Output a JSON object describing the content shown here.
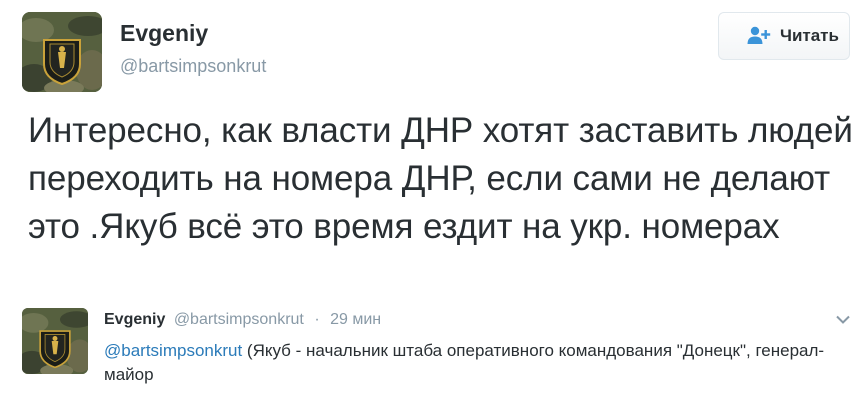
{
  "tweet": {
    "author": {
      "name": "Evgeniy",
      "handle": "@bartsimpsonkrut",
      "avatar_icon": "avatar-camo-icon"
    },
    "follow_button": {
      "label": "Читать",
      "icon": "follow-person-plus-icon",
      "icon_color": "#3b94d9"
    },
    "text": "Интересно, как власти ДНР хотят заставить людей переходить на номера ДНР, если сами не делают это .Якуб всё это время ездит на укр. номерах"
  },
  "quoted": {
    "author": {
      "name": "Evgeniy",
      "handle": "@bartsimpsonkrut",
      "avatar_icon": "avatar-camo-icon"
    },
    "separator": "·",
    "time": "29 мин",
    "mention": "@bartsimpsonkrut",
    "text": " (Якуб -  начальник штаба оперативного командования \"Донецк\", генерал-майор",
    "caret_icon": "chevron-down-icon"
  },
  "colors": {
    "text": "#292f33",
    "muted": "#8899a6",
    "link": "#2b7bb9",
    "accent": "#3b94d9"
  }
}
